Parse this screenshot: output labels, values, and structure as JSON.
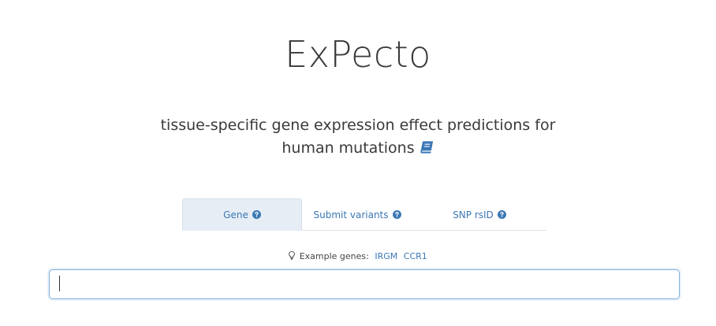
{
  "header": {
    "title": "ExPecto",
    "tagline_line1": "tissue-specific gene expression effect predictions for",
    "tagline_line2": "human mutations",
    "book_icon": "book-icon"
  },
  "tabs": [
    {
      "label": "Gene",
      "icon": "question-circle-icon",
      "active": true
    },
    {
      "label": "Submit variants",
      "icon": "question-circle-icon",
      "active": false
    },
    {
      "label": "SNP rsID",
      "icon": "question-circle-icon",
      "active": false
    }
  ],
  "examples": {
    "label": "Example genes:",
    "icon": "lightbulb-icon",
    "genes": [
      "IRGM",
      "CCR1"
    ]
  },
  "search": {
    "value": "",
    "placeholder": ""
  },
  "colors": {
    "accent": "#3b77b5",
    "active_tab_bg": "#e6edf5",
    "input_border": "#7fb0dc",
    "text": "#3a3a3a"
  }
}
